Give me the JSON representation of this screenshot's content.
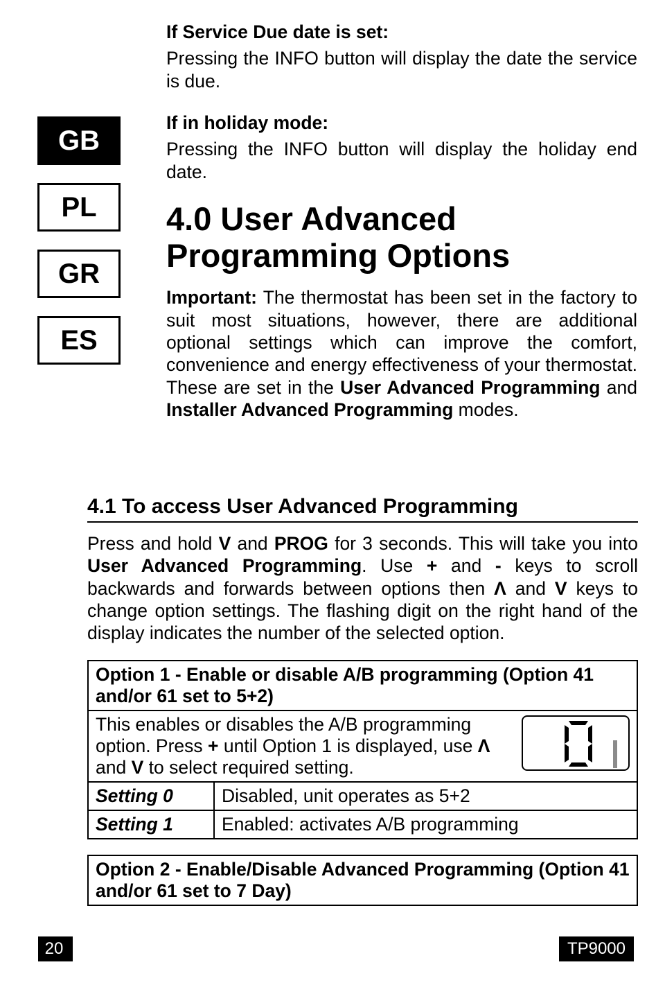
{
  "languages": [
    "GB",
    "PL",
    "GR",
    "ES"
  ],
  "active_language_index": 0,
  "section_a": {
    "heading1": "If Service Due date is set:",
    "body1": "Pressing the INFO button will display the date the service is due.",
    "heading2": "If in holiday mode:",
    "body2": "Pressing the INFO button will display the holiday end date."
  },
  "section_4_0": {
    "title": "4.0 User Advanced Programming Options",
    "important_label": "Important:",
    "important_body": " The thermostat has been set in the factory to suit most situations, however, there are additional optional settings which can improve the comfort, convenience and energy effectiveness of your thermostat. These are set in the ",
    "important_bold1": "User Advanced Programming",
    "important_mid": " and ",
    "important_bold2": "Installer Advanced Programming",
    "important_tail": " modes."
  },
  "section_4_1": {
    "title": "4.1 To access User Advanced Programming",
    "p1_a": "Press and hold ",
    "p1_b": "V",
    "p1_c": " and ",
    "p1_d": "PROG",
    "p1_e": " for 3 seconds. This will take you into ",
    "p1_f": "User Advanced Programming",
    "p1_g": ". Use ",
    "p1_h": "+",
    "p1_i": " and ",
    "p1_j": "-",
    "p1_k": " keys to scroll backwards and forwards between options then ",
    "p1_l": "Λ",
    "p1_m": " and ",
    "p1_n": "V",
    "p1_o": " keys to change option settings. The flashing digit on the right hand of the display indicates the number of the selected option."
  },
  "option1": {
    "header": "Option 1 -  Enable or disable A/B programming (Option 41 and/or 61 set to 5+2)",
    "body_a": "This enables or disables the A/B programming option. Press ",
    "body_b": "+",
    "body_c": " until Option 1 is displayed, use ",
    "body_d": "Λ",
    "body_e": " and ",
    "body_f": "V",
    "body_g": " to select required setting.",
    "row0_label": "Setting 0",
    "row0_val": "Disabled, unit operates as 5+2",
    "row1_label": "Setting 1",
    "row1_val": "Enabled: activates A/B programming",
    "lcd_main": "0",
    "lcd_small": "1"
  },
  "option2": {
    "header": "Option 2 - Enable/Disable Advanced Programming (Option 41 and/or 61 set to 7 Day)"
  },
  "footer": {
    "page": "20",
    "model": "TP9000"
  }
}
